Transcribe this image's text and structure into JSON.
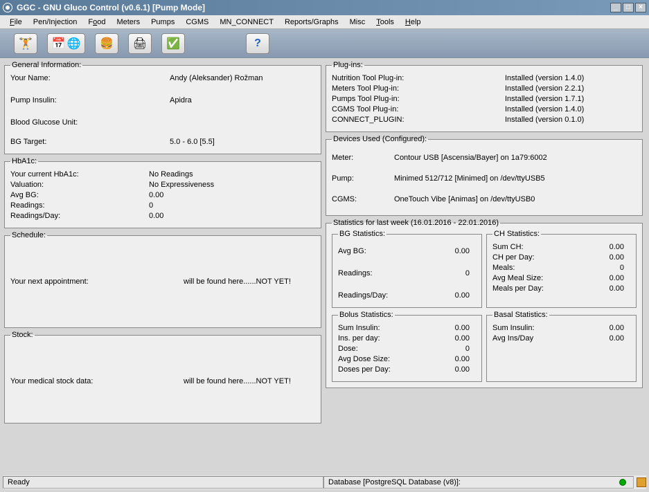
{
  "window": {
    "title": "GGC - GNU Gluco Control (v0.6.1) [Pump Mode]"
  },
  "menu": {
    "file": "File",
    "pen": "Pen/Injection",
    "food": "Food",
    "meters": "Meters",
    "pumps": "Pumps",
    "cgms": "CGMS",
    "mnconnect": "MN_CONNECT",
    "reports": "Reports/Graphs",
    "misc": "Misc",
    "tools": "Tools",
    "help": "Help"
  },
  "general": {
    "legend": "General Information:",
    "name_label": "Your Name:",
    "name_value": "Andy (Aleksander) Rožman",
    "pump_insulin_label": "Pump Insulin:",
    "pump_insulin_value": "Apidra",
    "bg_unit_label": "Blood Glucose Unit:",
    "bg_target_label": "BG Target:",
    "bg_target_value": "5.0 - 6.0 [5.5]"
  },
  "hba1c": {
    "legend": "HbA1c:",
    "current_label": "Your current HbA1c:",
    "current_value": "No Readings",
    "valuation_label": "Valuation:",
    "valuation_value": "No Expressiveness",
    "avgbg_label": "Avg BG:",
    "avgbg_value": "0.00",
    "readings_label": "Readings:",
    "readings_value": "0",
    "perday_label": "Readings/Day:",
    "perday_value": "0.00"
  },
  "schedule": {
    "legend": "Schedule:",
    "next_appt_label": "Your next appointment:",
    "next_appt_value": "will be found here......NOT YET!"
  },
  "stock": {
    "legend": "Stock:",
    "stock_label": "Your medical stock data:",
    "stock_value": "will be found here......NOT YET!"
  },
  "plugins": {
    "legend": "Plug-ins:",
    "rows": {
      "nutrition_label": "Nutrition Tool Plug-in:",
      "nutrition_value": "Installed (version 1.4.0)",
      "meters_label": "Meters Tool Plug-in:",
      "meters_value": "Installed (version 2.2.1)",
      "pumps_label": "Pumps Tool Plug-in:",
      "pumps_value": "Installed (version 1.7.1)",
      "cgms_label": "CGMS Tool Plug-in:",
      "cgms_value": "Installed (version 1.4.0)",
      "connect_label": "CONNECT_PLUGIN:",
      "connect_value": "Installed (version 0.1.0)"
    }
  },
  "devices": {
    "legend": "Devices Used (Configured):",
    "meter_label": "Meter:",
    "meter_value": "Contour USB [Ascensia/Bayer] on 1a79:6002",
    "pump_label": "Pump:",
    "pump_value": "Minimed 512/712 [Minimed] on /dev/ttyUSB5",
    "cgms_label": "CGMS:",
    "cgms_value": "OneTouch Vibe [Animas] on /dev/ttyUSB0"
  },
  "stats": {
    "legend": "Statistics for last week (16.01.2016 - 22.01.2016)",
    "bg_legend": "BG Statistics:",
    "bg_avg_label": "Avg BG:",
    "bg_avg_value": "0.00",
    "bg_read_label": "Readings:",
    "bg_read_value": "0",
    "bg_perday_label": "Readings/Day:",
    "bg_perday_value": "0.00",
    "ch_legend": "CH Statistics:",
    "ch_sum_label": "Sum CH:",
    "ch_sum_value": "0.00",
    "ch_perday_label": "CH per Day:",
    "ch_perday_value": "0.00",
    "ch_meals_label": "Meals:",
    "ch_meals_value": "0",
    "ch_avgmeal_label": "Avg Meal Size:",
    "ch_avgmeal_value": "0.00",
    "ch_mealsperday_label": "Meals per Day:",
    "ch_mealsperday_value": "0.00",
    "bolus_legend": "Bolus Statistics:",
    "bolus_sum_label": "Sum Insulin:",
    "bolus_sum_value": "0.00",
    "bolus_perday_label": "Ins. per day:",
    "bolus_perday_value": "0.00",
    "bolus_dose_label": "Dose:",
    "bolus_dose_value": "0",
    "bolus_avgdose_label": "Avg Dose Size:",
    "bolus_avgdose_value": "0.00",
    "bolus_dosesperday_label": "Doses per Day:",
    "bolus_dosesperday_value": "0.00",
    "basal_legend": "Basal Statistics:",
    "basal_sum_label": "Sum Insulin:",
    "basal_sum_value": "0.00",
    "basal_avg_label": "Avg Ins/Day",
    "basal_avg_value": "0.00"
  },
  "status": {
    "left": "Ready",
    "right": "Database [PostgreSQL Database (v8)]:"
  }
}
